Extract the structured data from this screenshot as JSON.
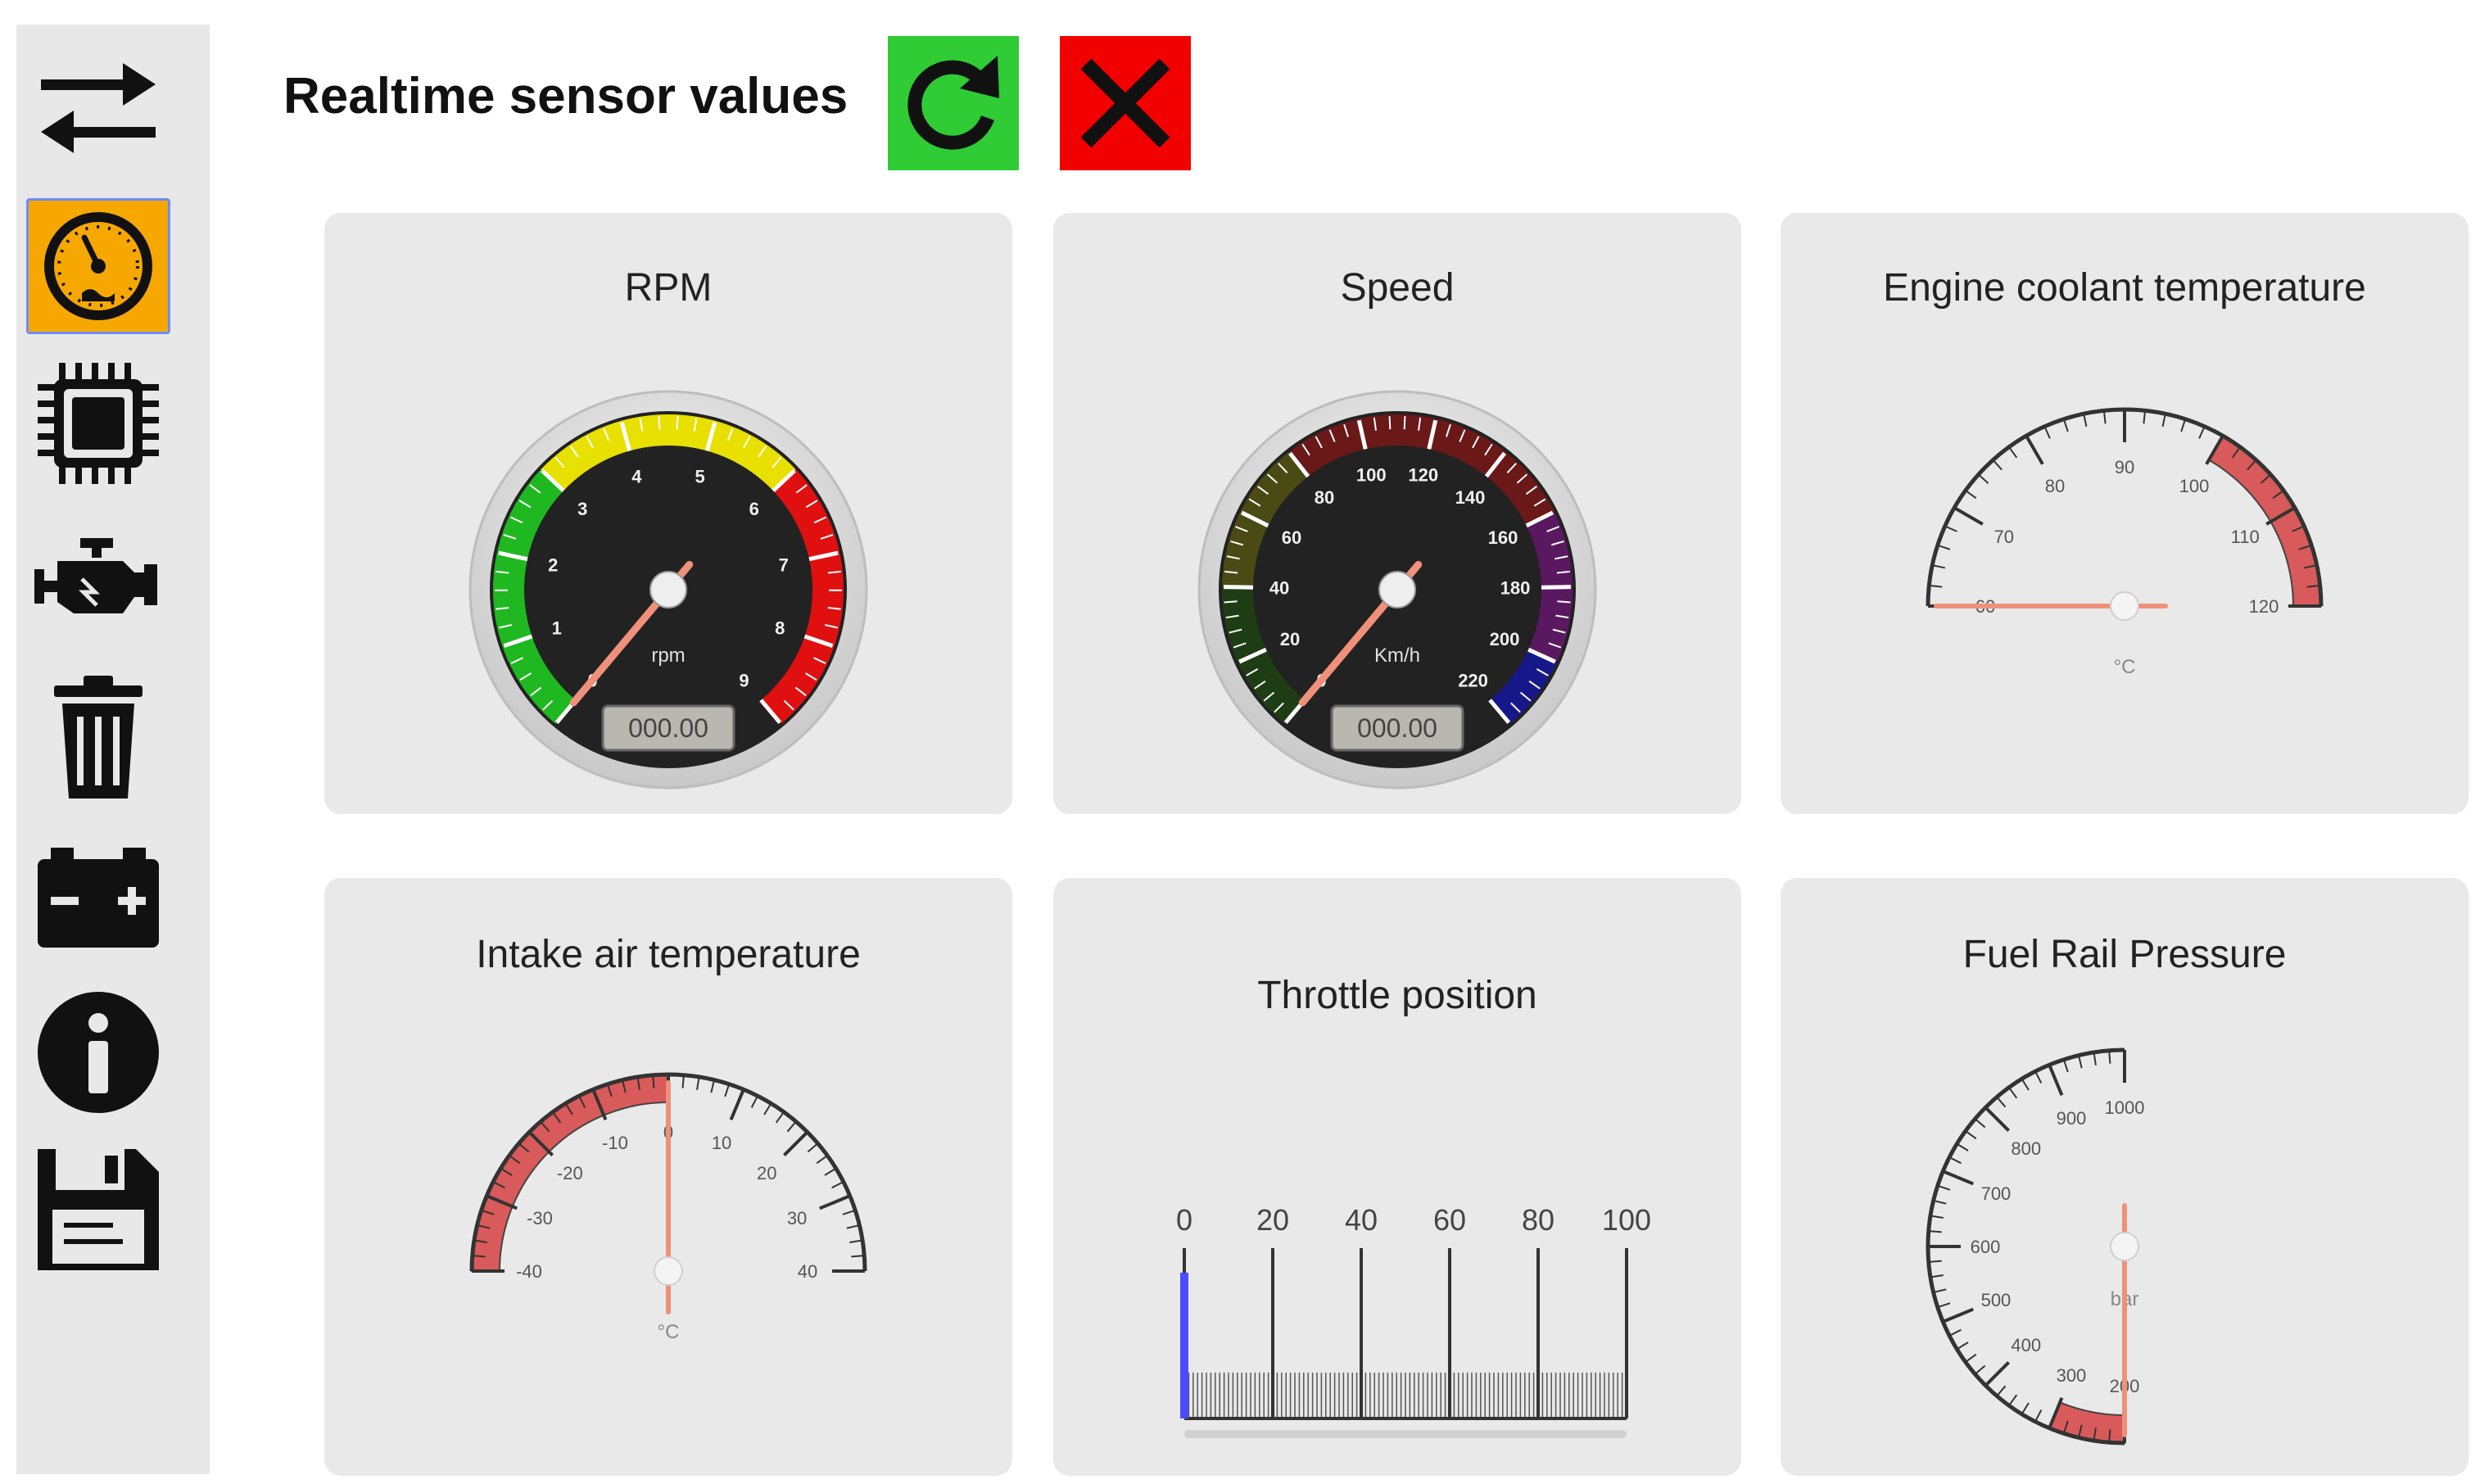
{
  "header": {
    "title": "Realtime sensor values"
  },
  "sidebar": {
    "items": [
      {
        "name": "transfer-icon",
        "active": false
      },
      {
        "name": "dashboard-gauge-icon",
        "active": true
      },
      {
        "name": "chip-icon",
        "active": false
      },
      {
        "name": "engine-icon",
        "active": false
      },
      {
        "name": "trash-icon",
        "active": false
      },
      {
        "name": "battery-icon",
        "active": false
      },
      {
        "name": "info-icon",
        "active": false
      },
      {
        "name": "save-icon",
        "active": false
      }
    ]
  },
  "toolbar": {
    "refresh_icon": "refresh-icon",
    "close_icon": "close-icon",
    "refresh_color": "#2fcc35",
    "close_color": "#f20000"
  },
  "gauges": {
    "rpm": {
      "title": "RPM",
      "unit": "rpm",
      "value": 0,
      "display": "000.00",
      "min": 0,
      "max": 9,
      "ticks": [
        "0",
        "1",
        "2",
        "3",
        "4",
        "5",
        "6",
        "7",
        "8",
        "9"
      ],
      "zones": [
        {
          "from": 0,
          "to": 3,
          "color": "#20b820"
        },
        {
          "from": 3,
          "to": 6,
          "color": "#e8e000"
        },
        {
          "from": 6,
          "to": 9,
          "color": "#e01010"
        }
      ]
    },
    "speed": {
      "title": "Speed",
      "unit": "Km/h",
      "value": 0,
      "display": "000.00",
      "min": 0,
      "max": 220,
      "ticks": [
        "0",
        "20",
        "40",
        "60",
        "80",
        "100",
        "120",
        "140",
        "160",
        "180",
        "200",
        "220"
      ],
      "zones": [
        {
          "from": 0,
          "to": 40,
          "color": "#1e3d14"
        },
        {
          "from": 40,
          "to": 80,
          "color": "#4a4a14"
        },
        {
          "from": 80,
          "to": 160,
          "color": "#6a1818"
        },
        {
          "from": 160,
          "to": 200,
          "color": "#5a1860"
        },
        {
          "from": 200,
          "to": 220,
          "color": "#16188a"
        }
      ]
    },
    "coolant": {
      "title": "Engine coolant temperature",
      "unit": "°C",
      "value": 60,
      "min": 60,
      "max": 120,
      "ticks": [
        "60",
        "70",
        "80",
        "90",
        "100",
        "110",
        "120"
      ],
      "zones": [
        {
          "from": 100,
          "to": 120,
          "color": "#d95a5a"
        }
      ]
    },
    "intake": {
      "title": "Intake air temperature",
      "unit": "°C",
      "value": 0,
      "min": -40,
      "max": 40,
      "ticks": [
        "-40",
        "-30",
        "-20",
        "-10",
        "0",
        "10",
        "20",
        "30",
        "40"
      ],
      "zones": [
        {
          "from": -40,
          "to": 0,
          "color": "#d95a5a"
        }
      ]
    },
    "throttle": {
      "title": "Throttle position",
      "value": 0,
      "min": 0,
      "max": 100,
      "ticks": [
        "0",
        "20",
        "40",
        "60",
        "80",
        "100"
      ],
      "bar_color": "#4b4bff"
    },
    "fuel_rail": {
      "title": "Fuel Rail Pressure",
      "unit": "bar",
      "value": 200,
      "min": 200,
      "max": 1000,
      "ticks": [
        "200",
        "300",
        "400",
        "500",
        "600",
        "700",
        "800",
        "900",
        "1000"
      ],
      "zones": [
        {
          "from": 200,
          "to": 300,
          "color": "#d95a5a"
        }
      ]
    }
  }
}
